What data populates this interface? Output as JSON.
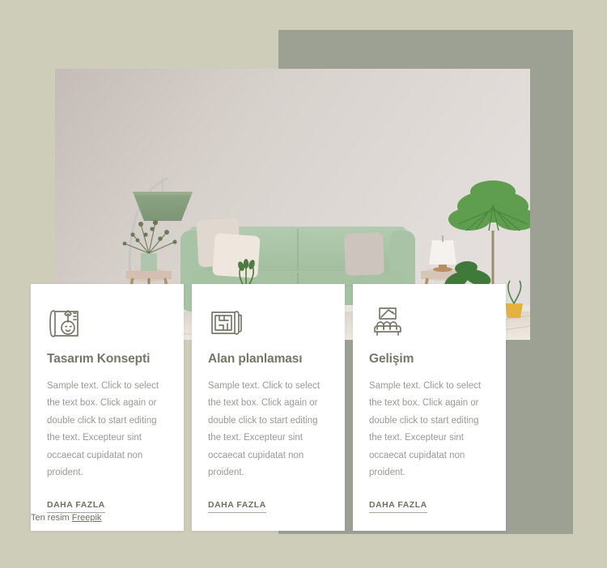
{
  "page": {
    "background_color": "#cdcdb9",
    "accent_block_color": "#9ca193"
  },
  "hero": {
    "alt": "living-room-photo",
    "icon": "interior-photo"
  },
  "cards": [
    {
      "icon": "blueprint-compass-icon",
      "title": "Tasarım Konsepti",
      "body": "Sample text. Click to select the text box. Click again or double click to start editing the text. Excepteur sint occaecat cupidatat non proident.",
      "link_label": "DAHA FAZLA"
    },
    {
      "icon": "floor-plan-icon",
      "title": "Alan planlaması",
      "body": "Sample text. Click to select the text box. Click again or double click to start editing the text. Excepteur sint occaecat cupidatat non proident.",
      "link_label": "DAHA FAZLA"
    },
    {
      "icon": "sofa-artwork-icon",
      "title": "Gelişim",
      "body": "Sample text. Click to select the text box. Click again or double click to start editing the text. Excepteur sint occaecat cupidatat non proident.",
      "link_label": "DAHA FAZLA"
    }
  ],
  "credit": {
    "prefix": "Ten resim ",
    "link_label": "Freepik"
  },
  "colors": {
    "title": "#767668",
    "body": "#9a9a94",
    "link": "#6f6f62",
    "icon_stroke": "#77776a",
    "card_bg": "#ffffff"
  }
}
